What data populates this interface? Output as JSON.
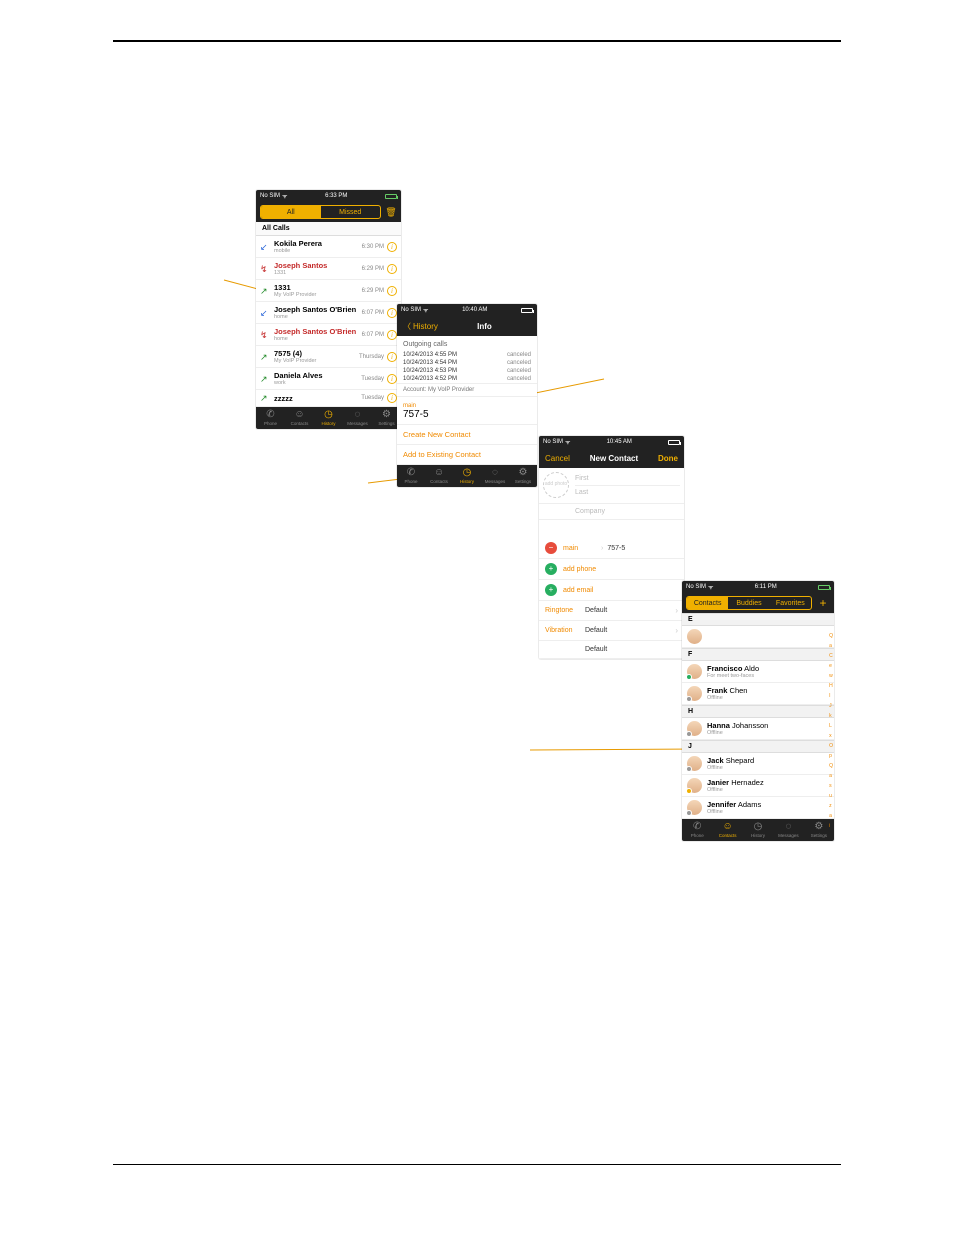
{
  "history": {
    "status": {
      "carrier": "No SIM",
      "time": "6:33 PM"
    },
    "tabs": {
      "all": "All",
      "missed": "Missed"
    },
    "section": "All Calls",
    "calls": [
      {
        "name_first": "Kokila",
        "name_last": "Perera",
        "sub": "mobile",
        "time": "6:30 PM",
        "type": "in"
      },
      {
        "name_first": "Joseph",
        "name_last": "Santos",
        "sub": "1331",
        "time": "6:29 PM",
        "type": "miss"
      },
      {
        "name_first": "1331",
        "name_last": "",
        "sub": "My VoIP Provider",
        "time": "6:29 PM",
        "type": "out"
      },
      {
        "name_first": "Joseph",
        "name_last": "Santos O'Brien",
        "sub": "home",
        "time": "6:07 PM",
        "type": "in"
      },
      {
        "name_first": "Joseph",
        "name_last": "Santos O'Brien",
        "sub": "home",
        "time": "6:07 PM",
        "type": "miss"
      },
      {
        "name_first": "7575",
        "name_last": "(4)",
        "sub": "My VoIP Provider",
        "time": "Thursday",
        "type": "out"
      },
      {
        "name_first": "Daniela",
        "name_last": "Alves",
        "sub": "work",
        "time": "Tuesday",
        "type": "out"
      },
      {
        "name_first": "zzzzz",
        "name_last": "",
        "sub": "",
        "time": "Tuesday",
        "type": "out"
      }
    ],
    "tabbar": {
      "phone": "Phone",
      "contacts": "Contacts",
      "history": "History",
      "messages": "Messages",
      "settings": "Settings"
    }
  },
  "info": {
    "status": {
      "carrier": "No SIM",
      "time": "10:40 AM"
    },
    "back": "History",
    "title": "Info",
    "section": "Outgoing calls",
    "entries": [
      {
        "dt": "10/24/2013 4:55 PM",
        "st": "canceled"
      },
      {
        "dt": "10/24/2013 4:54 PM",
        "st": "canceled"
      },
      {
        "dt": "10/24/2013 4:53 PM",
        "st": "canceled"
      },
      {
        "dt": "10/24/2013 4:52 PM",
        "st": "canceled"
      }
    ],
    "account": "Account: My VoIP Provider",
    "num_label": "main",
    "num": "757-5",
    "create": "Create New Contact",
    "add": "Add to Existing Contact"
  },
  "newcontact": {
    "status": {
      "carrier": "No SIM",
      "time": "10:45 AM"
    },
    "cancel": "Cancel",
    "title": "New Contact",
    "done": "Done",
    "addphoto": "add photo",
    "first": "First",
    "last": "Last",
    "company": "Company",
    "phone_label": "main",
    "phone_val": "757-5",
    "add_phone": "add phone",
    "add_email": "add email",
    "ringtone_lbl": "Ringtone",
    "ringtone_val": "Default",
    "vibration_lbl": "Vibration",
    "vibration_val": "Default",
    "texttone_val": "Default"
  },
  "contacts": {
    "status": {
      "carrier": "No SIM",
      "time": "6:11 PM"
    },
    "tabs": {
      "contacts": "Contacts",
      "buddies": "Buddies",
      "favorites": "Favorites"
    },
    "sections": [
      {
        "letter": "E",
        "items": [
          {
            "first": "",
            "last": "",
            "sub": ""
          }
        ]
      },
      {
        "letter": "F",
        "items": [
          {
            "first": "Francisco",
            "last": "Aldo",
            "sub": "For meet two-faces",
            "pres": "on"
          },
          {
            "first": "Frank",
            "last": "Chen",
            "sub": "Offline",
            "pres": "off"
          }
        ]
      },
      {
        "letter": "H",
        "items": [
          {
            "first": "Hanna",
            "last": "Johansson",
            "sub": "Offline",
            "pres": "off"
          }
        ]
      },
      {
        "letter": "J",
        "items": [
          {
            "first": "Jack",
            "last": "Shepard",
            "sub": "Offline",
            "pres": "off"
          },
          {
            "first": "Janier",
            "last": "Hernadez",
            "sub": "Offline",
            "pres": "away"
          },
          {
            "first": "Jennifer",
            "last": "Adams",
            "sub": "Offline",
            "pres": "off"
          }
        ]
      }
    ],
    "index": [
      "Q",
      "a",
      "C",
      "e",
      "w",
      "H",
      "I",
      "J",
      "k",
      "L",
      "x",
      "O",
      "p",
      "Q",
      "a",
      "s",
      "u",
      "z",
      "a",
      "i"
    ],
    "tabbar": {
      "phone": "Phone",
      "contacts": "Contacts",
      "history": "History",
      "messages": "Messages",
      "settings": "Settings"
    }
  }
}
